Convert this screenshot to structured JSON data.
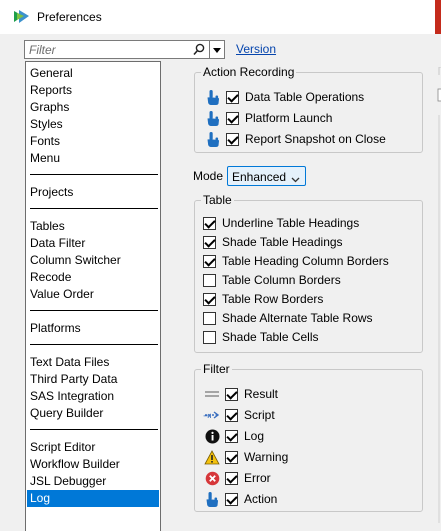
{
  "window": {
    "title": "Preferences",
    "accent": "#c42b1c"
  },
  "toolbar": {
    "filter_placeholder": "Filter",
    "version_link": "Version"
  },
  "nav": {
    "groups": [
      [
        "General",
        "Reports",
        "Graphs",
        "Styles",
        "Fonts",
        "Menu"
      ],
      [
        "Projects"
      ],
      [
        "Tables",
        "Data Filter",
        "Column Switcher",
        "Recode",
        "Value Order"
      ],
      [
        "Platforms"
      ],
      [
        "Text Data Files",
        "Third Party Data",
        "SAS Integration",
        "Query Builder"
      ],
      [
        "Script Editor",
        "Workflow Builder",
        "JSL Debugger",
        "Log"
      ]
    ],
    "selected": "Log",
    "selection_color": "#0078d7"
  },
  "action_recording": {
    "label": "Action Recording",
    "items": [
      {
        "label": "Data Table Operations",
        "checked": true,
        "icon": "hand-pointer-icon"
      },
      {
        "label": "Platform Launch",
        "checked": true,
        "icon": "hand-pointer-icon"
      },
      {
        "label": "Report Snapshot on Close",
        "checked": true,
        "icon": "hand-pointer-icon"
      }
    ]
  },
  "mode": {
    "label": "Mode",
    "value": "Enhanced"
  },
  "table": {
    "label": "Table",
    "items": [
      {
        "label": "Underline Table Headings",
        "checked": true
      },
      {
        "label": "Shade Table Headings",
        "checked": true
      },
      {
        "label": "Table Heading Column Borders",
        "checked": true
      },
      {
        "label": "Table Column Borders",
        "checked": false
      },
      {
        "label": "Table Row Borders",
        "checked": true
      },
      {
        "label": "Shade Alternate Table Rows",
        "checked": false
      },
      {
        "label": "Shade Table Cells",
        "checked": false
      }
    ]
  },
  "filter": {
    "label": "Filter",
    "items": [
      {
        "label": "Result",
        "checked": true,
        "icon": "result-lines-icon"
      },
      {
        "label": "Script",
        "checked": true,
        "icon": "script-arrow-icon"
      },
      {
        "label": "Log",
        "checked": true,
        "icon": "info-icon"
      },
      {
        "label": "Warning",
        "checked": true,
        "icon": "warning-icon"
      },
      {
        "label": "Error",
        "checked": true,
        "icon": "error-icon"
      },
      {
        "label": "Action",
        "checked": true,
        "icon": "hand-pointer-icon"
      }
    ]
  }
}
